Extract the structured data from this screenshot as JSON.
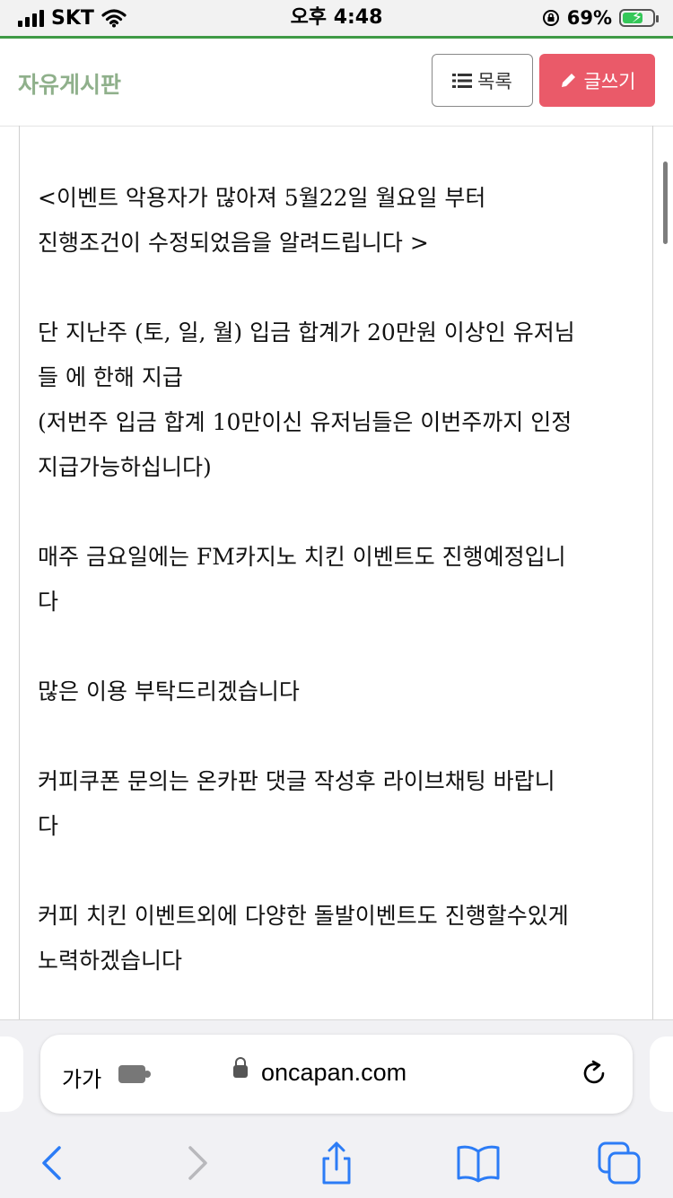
{
  "status_bar": {
    "carrier": "SKT",
    "time": "오후 4:48",
    "battery_percent": "69%",
    "battery_level": 0.69
  },
  "header": {
    "title": "자유게시판",
    "list_button": "목록",
    "write_button": "글쓰기",
    "accent_color": "#ea5a69",
    "title_color": "#8fb08b"
  },
  "post": {
    "paragraphs": [
      "<이벤트 악용자가 많아져 5월22일 월요일 부터\n진행조건이 수정되었음을 알려드립니다 >",
      "단 지난주 (토, 일, 월) 입금 합계가 20만원 이상인 유저님\n들 에 한해 지급\n(저번주 입금 합계 10만이신 유저님들은 이번주까지 인정\n지급가능하십니다)",
      "매주 금요일에는 FM카지노 치킨 이벤트도 진행예정입니\n다",
      "많은 이용 부탁드리겠습니다",
      "커피쿠폰 문의는 온카판 댓글 작성후 라이브채팅 바랍니\n다",
      "커피 치킨 이벤트외에 다양한 돌발이벤트도 진행할수있게\n노력하겠습니다"
    ]
  },
  "browser": {
    "aa_label": "가가",
    "url": "oncapan.com",
    "icons": [
      "extension-icon",
      "lock-icon",
      "reload-icon",
      "back-icon",
      "forward-icon",
      "share-icon",
      "bookmarks-icon",
      "tabs-icon"
    ]
  }
}
